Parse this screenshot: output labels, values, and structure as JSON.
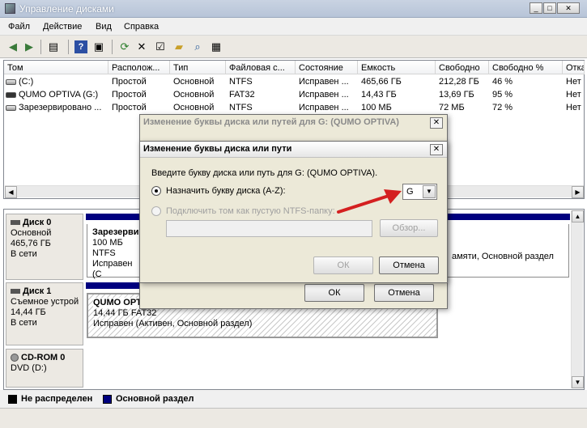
{
  "window": {
    "title": "Управление дисками",
    "controls": [
      "_",
      "□",
      "✕"
    ]
  },
  "menu": [
    "Файл",
    "Действие",
    "Вид",
    "Справка"
  ],
  "toolbar": [
    "back-icon",
    "forward-icon",
    "console-tree-icon",
    "help-icon",
    "console-icon",
    "refresh-icon",
    "delete-icon",
    "properties-icon",
    "open-icon",
    "search-icon",
    "settings-icon"
  ],
  "volumes": {
    "columns": [
      "Том",
      "Располож...",
      "Тип",
      "Файловая с...",
      "Состояние",
      "Емкость",
      "Свободно",
      "Свободно %",
      "Отка"
    ],
    "rows": [
      [
        "(C:)",
        "Простой",
        "Основной",
        "NTFS",
        "Исправен ...",
        "465,66 ГБ",
        "212,28 ГБ",
        "46 %",
        "Нет"
      ],
      [
        "QUMO OPTIVA (G:)",
        "Простой",
        "Основной",
        "FAT32",
        "Исправен ...",
        "14,43 ГБ",
        "13,69 ГБ",
        "95 %",
        "Нет"
      ],
      [
        "Зарезервировано ...",
        "Простой",
        "Основной",
        "NTFS",
        "Исправен ...",
        "100 МБ",
        "72 МБ",
        "72 %",
        "Нет"
      ]
    ]
  },
  "disks": {
    "disk0": {
      "name": "Диск 0",
      "type": "Основной",
      "size": "465,76 ГБ",
      "state": "В сети",
      "part_title": "Зарезерви",
      "part_size": "100 МБ NTFS",
      "part_state": "Исправен (С",
      "right_text": "амяти, Основной раздел"
    },
    "disk1": {
      "name": "Диск 1",
      "type": "Съемное устрой",
      "size": "14,44 ГБ",
      "state": "В сети",
      "part_title": "QUMO OPT",
      "part_size": "14,44 ГБ FAT32",
      "part_state": "Исправен (Активен, Основной раздел)"
    },
    "cdrom": {
      "name": "CD-ROM 0",
      "type": "DVD (D:)"
    }
  },
  "legend": {
    "unallocated": "Не распределен",
    "primary": "Основной раздел",
    "unallocated_color": "#000000",
    "primary_color": "#00007f"
  },
  "outer_dialog": {
    "title": "Изменение буквы диска или путей для G: (QUMO OPTIVA)",
    "ok": "ОК",
    "cancel": "Отмена"
  },
  "inner_dialog": {
    "title": "Изменение буквы диска или пути",
    "prompt": "Введите букву диска или путь для G: (QUMO OPTIVA).",
    "assign_letter": "Назначить букву диска (A-Z):",
    "letter": "G",
    "mount_empty": "Подключить том как пустую NTFS-папку:",
    "browse": "Обзор...",
    "ok": "ОК",
    "cancel": "Отмена"
  }
}
